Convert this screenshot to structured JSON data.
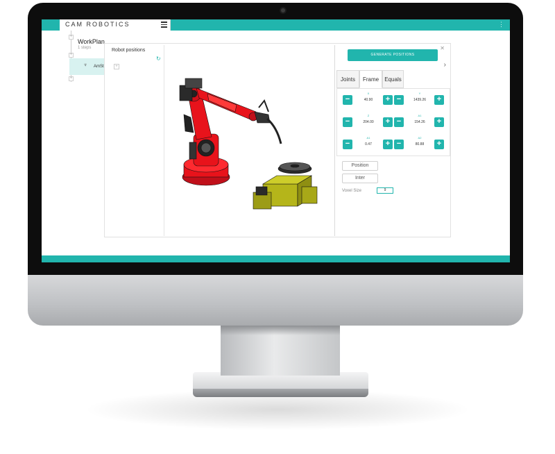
{
  "app": {
    "logo": "CAM ROBOTICS",
    "menu_icon": "hamburger-menu-icon",
    "accent": "#21b5ad"
  },
  "workplan": {
    "title": "WorkPlan",
    "steps_count": "1 steps",
    "step_item_label": "AmSt",
    "step_item_icon": "robot-tool-icon"
  },
  "robot_positions": {
    "title": "Robot positions",
    "refresh_icon": "refresh-icon"
  },
  "sidebar": {
    "generate_button": "GENERATE POSITIONS",
    "close_icon": "close-icon",
    "next_icon": "chevron-right-icon",
    "tabs": [
      {
        "label": "Joints",
        "active": false
      },
      {
        "label": "Frame",
        "active": true
      },
      {
        "label": "Equals",
        "active": false
      }
    ],
    "jog": [
      {
        "left_label": "X",
        "left_value": "40.90",
        "right_label": "Y",
        "right_value": "1439.26"
      },
      {
        "left_label": "Z",
        "left_value": "204.00",
        "right_label": "A1",
        "right_value": "154.26"
      },
      {
        "left_label": "A1",
        "left_value": "0.47",
        "right_label": "A2",
        "right_value": "80.88"
      }
    ],
    "minus": "−",
    "plus": "+",
    "position_button": "Position",
    "inter_button": "Inter",
    "voxel_label": "Voxel Size",
    "voxel_value": "9"
  },
  "scene": {
    "robot_color": "#e8131b",
    "positioner_color": "#b5b51a"
  }
}
